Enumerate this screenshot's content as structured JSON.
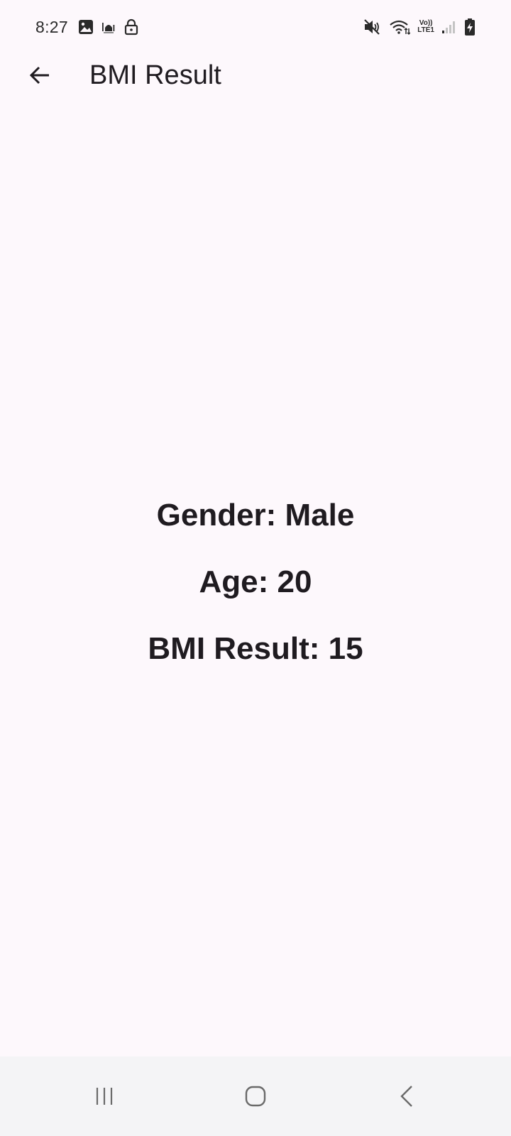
{
  "status_bar": {
    "time": "8:27",
    "network_top": "Vo))",
    "network_bottom": "LTE1"
  },
  "app_bar": {
    "title": "BMI Result"
  },
  "result": {
    "gender": "Gender: Male",
    "age": "Age: 20",
    "bmi": "BMI Result: 15"
  },
  "colors": {
    "background": "#fdf8fc",
    "text": "#1f1b20",
    "nav_bar": "#f4f4f6"
  },
  "icons": {
    "back": "arrow-left-icon",
    "recents": "recents-icon",
    "home": "home-icon",
    "nav_back": "chevron-left-icon"
  }
}
